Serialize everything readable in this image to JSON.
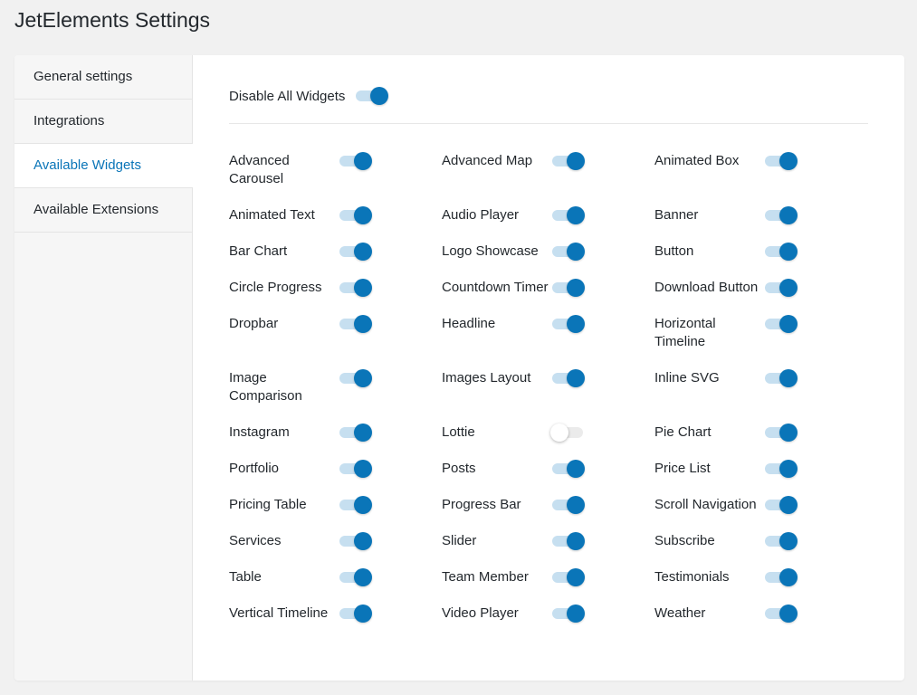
{
  "page": {
    "title": "JetElements Settings"
  },
  "sidebar": {
    "items": [
      {
        "label": "General settings",
        "active": false
      },
      {
        "label": "Integrations",
        "active": false
      },
      {
        "label": "Available Widgets",
        "active": true
      },
      {
        "label": "Available Extensions",
        "active": false
      }
    ]
  },
  "master_toggle": {
    "label": "Disable All Widgets",
    "on": true
  },
  "colors": {
    "accent": "#0a75b8",
    "track_on": "#c6dff0",
    "track_off": "#ebebeb",
    "background": "#f1f1f1"
  },
  "widgets": [
    {
      "label": "Advanced Carousel",
      "on": true
    },
    {
      "label": "Advanced Map",
      "on": true
    },
    {
      "label": "Animated Box",
      "on": true
    },
    {
      "label": "Animated Text",
      "on": true
    },
    {
      "label": "Audio Player",
      "on": true
    },
    {
      "label": "Banner",
      "on": true
    },
    {
      "label": "Bar Chart",
      "on": true
    },
    {
      "label": "Logo Showcase",
      "on": true
    },
    {
      "label": "Button",
      "on": true
    },
    {
      "label": "Circle Progress",
      "on": true
    },
    {
      "label": "Countdown Timer",
      "on": true
    },
    {
      "label": "Download Button",
      "on": true
    },
    {
      "label": "Dropbar",
      "on": true
    },
    {
      "label": "Headline",
      "on": true
    },
    {
      "label": "Horizontal Timeline",
      "on": true
    },
    {
      "label": "Image Comparison",
      "on": true
    },
    {
      "label": "Images Layout",
      "on": true
    },
    {
      "label": "Inline SVG",
      "on": true
    },
    {
      "label": "Instagram",
      "on": true
    },
    {
      "label": "Lottie",
      "on": false
    },
    {
      "label": "Pie Chart",
      "on": true
    },
    {
      "label": "Portfolio",
      "on": true
    },
    {
      "label": "Posts",
      "on": true
    },
    {
      "label": "Price List",
      "on": true
    },
    {
      "label": "Pricing Table",
      "on": true
    },
    {
      "label": "Progress Bar",
      "on": true
    },
    {
      "label": "Scroll Navigation",
      "on": true
    },
    {
      "label": "Services",
      "on": true
    },
    {
      "label": "Slider",
      "on": true
    },
    {
      "label": "Subscribe",
      "on": true
    },
    {
      "label": "Table",
      "on": true
    },
    {
      "label": "Team Member",
      "on": true
    },
    {
      "label": "Testimonials",
      "on": true
    },
    {
      "label": "Vertical Timeline",
      "on": true
    },
    {
      "label": "Video Player",
      "on": true
    },
    {
      "label": "Weather",
      "on": true
    }
  ]
}
